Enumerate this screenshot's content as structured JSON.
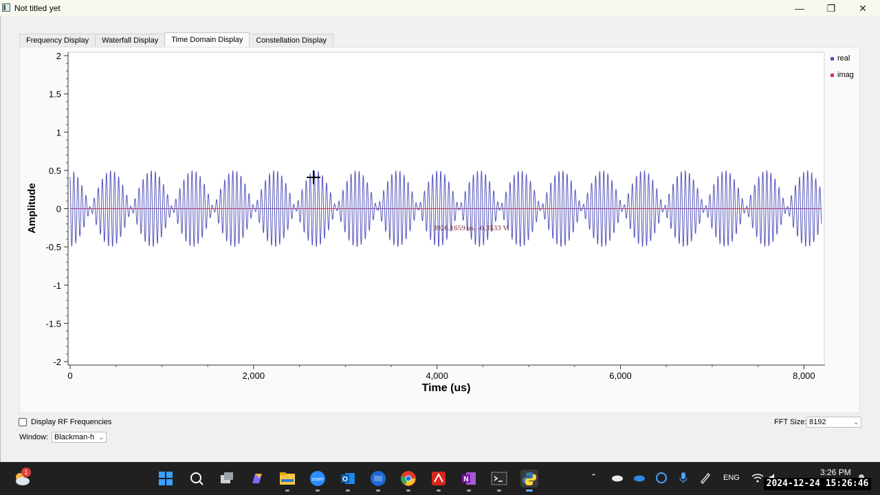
{
  "window": {
    "title": "Not titled yet",
    "min_glyph": "—",
    "max_glyph": "❐",
    "close_glyph": "✕"
  },
  "tabs": [
    {
      "label": "Frequency Display",
      "active": false
    },
    {
      "label": "Waterfall Display",
      "active": false
    },
    {
      "label": "Time Domain Display",
      "active": true
    },
    {
      "label": "Constellation Display",
      "active": false
    }
  ],
  "chart_data": {
    "type": "line",
    "xlabel": "Time (us)",
    "ylabel": "Amplitude",
    "xlim": [
      0,
      8192
    ],
    "ylim": [
      -2,
      2
    ],
    "x_ticks": [
      0,
      2000,
      4000,
      6000,
      8000
    ],
    "x_tick_labels": [
      "0",
      "2,000",
      "4,000",
      "6,000",
      "8,000"
    ],
    "y_ticks": [
      2,
      1.5,
      1,
      0.5,
      0,
      -0.5,
      -1,
      -1.5,
      -2
    ],
    "y_tick_labels": [
      "2",
      "1.5",
      "1",
      "0.5",
      "0",
      "-0.5",
      "-1",
      "-1.5",
      "-2"
    ],
    "series": [
      {
        "name": "real",
        "color": "#5555bb",
        "carrier_freq_per_us": 0.0225,
        "envelope_freq_per_us": 0.00224,
        "amplitude": 0.5
      },
      {
        "name": "imag",
        "color": "#cc3355",
        "constant": 0
      }
    ],
    "legend": "top-right",
    "grid": false
  },
  "tracker_text": "3926.1659 us, -0.3533 V",
  "controls": {
    "rf_label": "Display RF Frequencies",
    "rf_checked": false,
    "window_label": "Window:",
    "window_value": "Blackman-h",
    "fft_label": "FFT Size:",
    "fft_value": "8192"
  },
  "taskbar": {
    "weather_badge": "1",
    "clock_time": "3:26 PM",
    "overlay_datetime": "2024-12-24 15:26:46",
    "language": "ENG",
    "icons": [
      "start-icon",
      "search-icon",
      "task-view-icon",
      "copilot-icon",
      "file-explorer-icon",
      "zoom-icon",
      "outlook-icon",
      "python-idle-icon",
      "chrome-icon",
      "acrobat-icon",
      "onenote-icon",
      "terminal-icon",
      "python-icon"
    ]
  }
}
